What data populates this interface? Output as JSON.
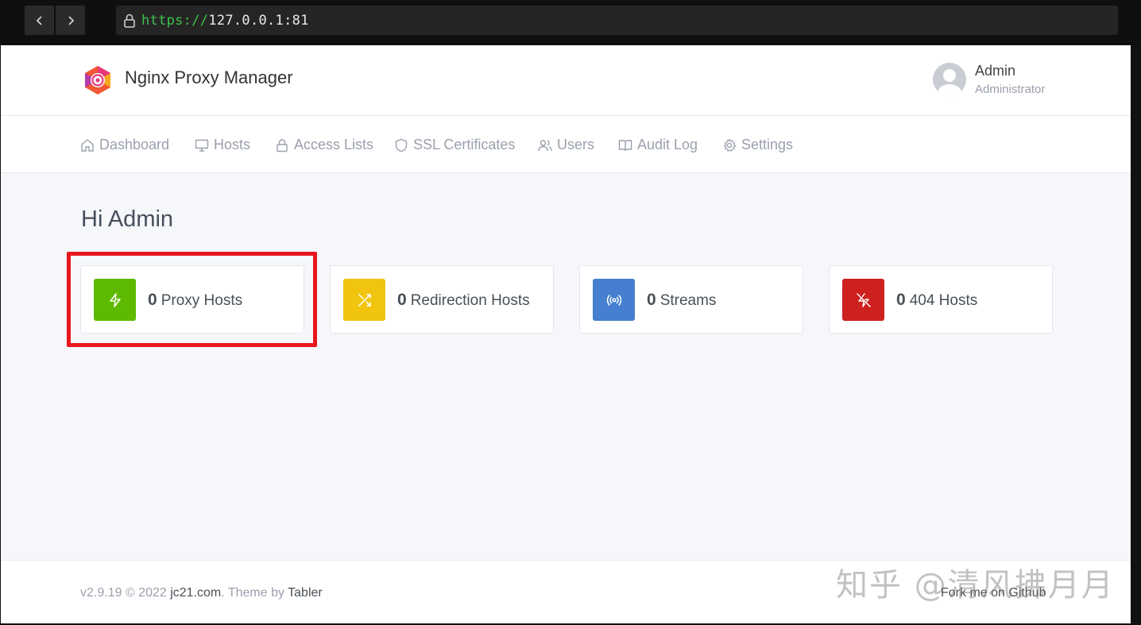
{
  "browser": {
    "url_scheme": "https://",
    "url_rest": "127.0.0.1:81",
    "back_icon": "chevron-left-icon",
    "forward_icon": "chevron-right-icon"
  },
  "header": {
    "brand": "Nginx Proxy Manager",
    "user_name": "Admin",
    "user_role": "Administrator"
  },
  "nav": {
    "items": [
      {
        "label": "Dashboard",
        "icon": "home-icon"
      },
      {
        "label": "Hosts",
        "icon": "monitor-icon"
      },
      {
        "label": "Access Lists",
        "icon": "lock-icon"
      },
      {
        "label": "SSL Certificates",
        "icon": "shield-icon"
      },
      {
        "label": "Users",
        "icon": "users-icon"
      },
      {
        "label": "Audit Log",
        "icon": "book-icon"
      },
      {
        "label": "Settings",
        "icon": "gear-icon"
      }
    ]
  },
  "main": {
    "greeting": "Hi Admin",
    "cards": [
      {
        "count": "0",
        "label": "Proxy Hosts",
        "color": "#5eba00",
        "icon": "zap-icon"
      },
      {
        "count": "0",
        "label": "Redirection Hosts",
        "color": "#f1c40f",
        "icon": "shuffle-icon"
      },
      {
        "count": "0",
        "label": "Streams",
        "color": "#467fcf",
        "icon": "radio-icon"
      },
      {
        "count": "0",
        "label": "404 Hosts",
        "color": "#cd201f",
        "icon": "zap-off-icon"
      }
    ]
  },
  "footer": {
    "version": "v2.9.19 © 2022 ",
    "site": "jc21.com",
    "theme_by": ". Theme by ",
    "theme": "Tabler",
    "fork": "Fork me on Github"
  },
  "watermark": "知乎 @清风拂月月",
  "colors": {
    "highlight": "#e8161b",
    "url_scheme": "#3cc24b"
  }
}
